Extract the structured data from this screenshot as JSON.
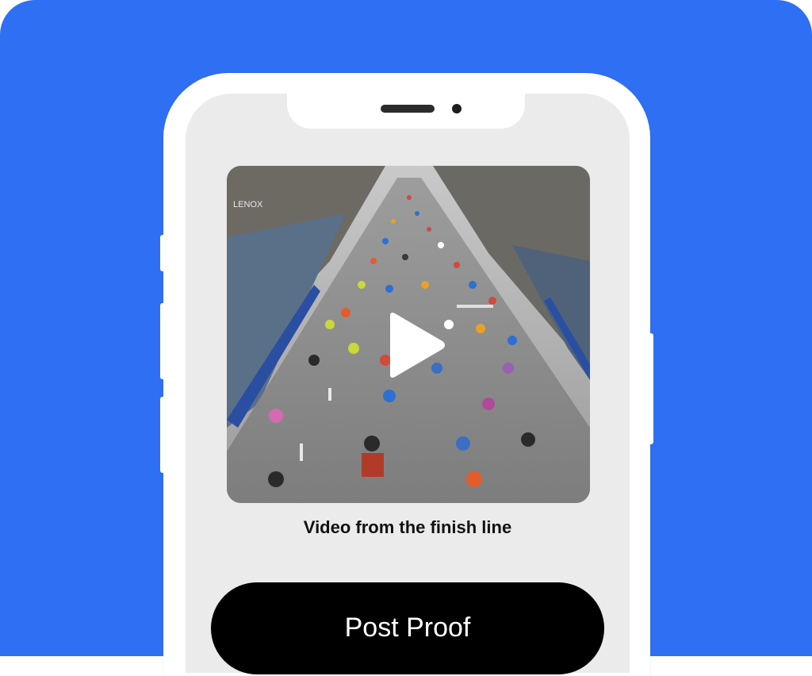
{
  "video": {
    "caption": "Video from the finish line",
    "play_icon": "play-icon",
    "banner_text": "LENOX"
  },
  "actions": {
    "post_proof_label": "Post Proof"
  },
  "colors": {
    "background": "#2f6ff4",
    "phone_frame": "#ffffff",
    "screen": "#ebebeb",
    "button": "#000000",
    "button_text": "#ffffff"
  }
}
